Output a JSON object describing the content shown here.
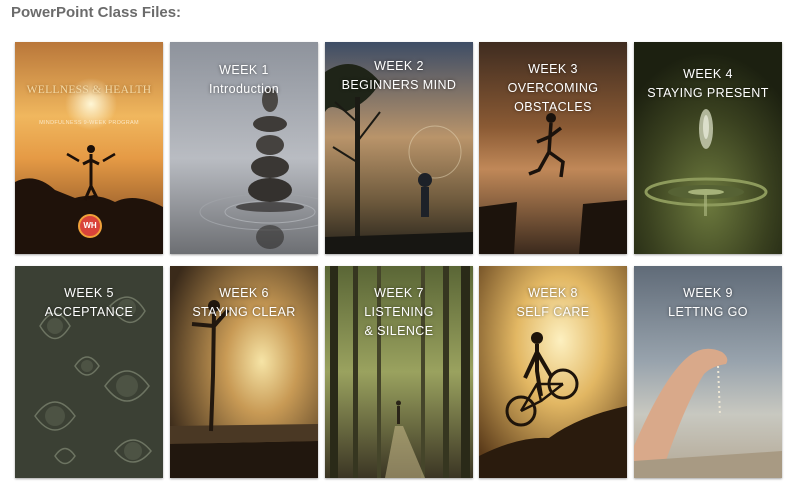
{
  "heading": "PowerPoint Class Files:",
  "cover": {
    "title": "WELLNESS & HEALTH",
    "subtitle": "MINDFULNESS 9-WEEK PROGRAM",
    "logo_text": "WH"
  },
  "cards": [
    {
      "lines": [
        "WEEK 1",
        "Introduction"
      ]
    },
    {
      "lines": [
        "WEEK 2",
        "BEGINNERS MIND"
      ]
    },
    {
      "lines": [
        "WEEK 3",
        "OVERCOMING",
        "OBSTACLES"
      ]
    },
    {
      "lines": [
        "WEEK 4",
        "STAYING PRESENT"
      ]
    },
    {
      "lines": [
        "WEEK 5",
        "ACCEPTANCE"
      ]
    },
    {
      "lines": [
        "WEEK 6",
        "STAYING CLEAR"
      ]
    },
    {
      "lines": [
        "WEEK 7",
        "LISTENING",
        "& SILENCE"
      ]
    },
    {
      "lines": [
        "WEEK 8",
        "SELF CARE"
      ]
    },
    {
      "lines": [
        "WEEK 9",
        "LETTING GO"
      ]
    }
  ]
}
